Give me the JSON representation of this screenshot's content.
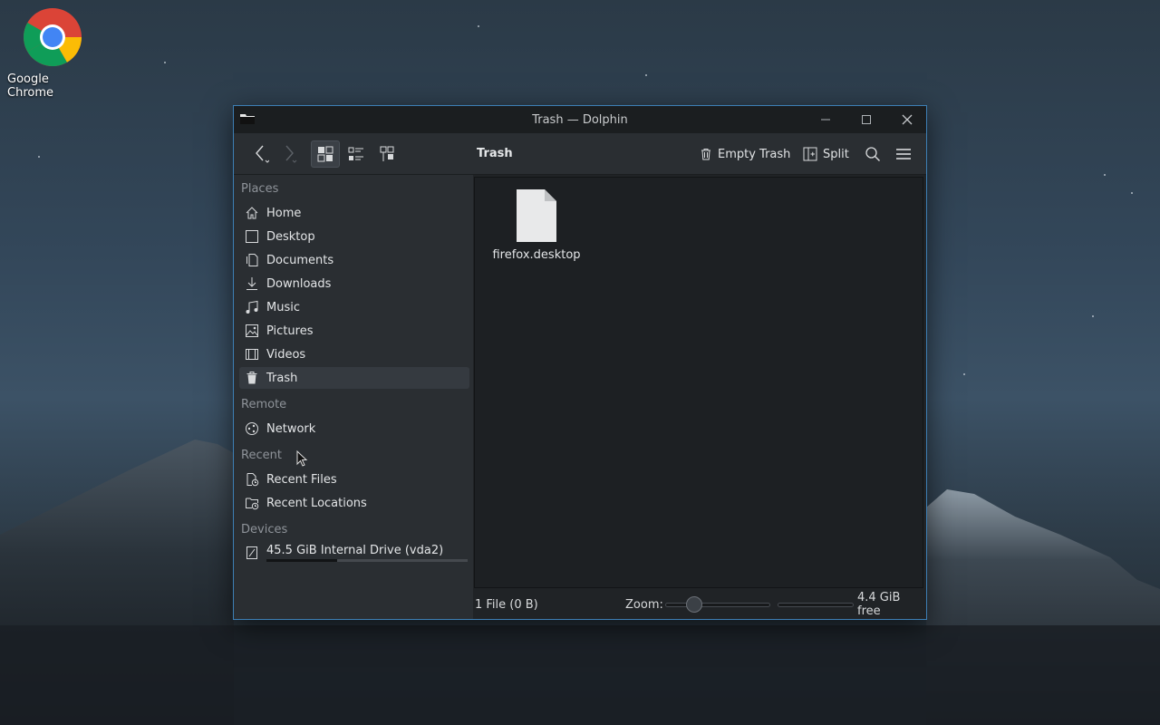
{
  "desktop": {
    "icons": [
      {
        "label": "Google Chrome",
        "icon": "chrome-icon"
      }
    ]
  },
  "window": {
    "title": "Trash — Dolphin",
    "accent": "#3d7fb5",
    "controls": [
      "minimize-icon",
      "maximize-icon",
      "close-icon"
    ]
  },
  "toolbar": {
    "location": "Trash",
    "empty_trash_label": "Empty Trash",
    "split_label": "Split",
    "view_modes": [
      "icons-view",
      "compact-view",
      "details-view"
    ],
    "active_view": "icons-view"
  },
  "sidebar": {
    "sections": {
      "places": "Places",
      "remote": "Remote",
      "recent": "Recent",
      "devices": "Devices"
    },
    "places": [
      {
        "label": "Home",
        "icon": "home-icon"
      },
      {
        "label": "Desktop",
        "icon": "desktop-icon"
      },
      {
        "label": "Documents",
        "icon": "documents-icon"
      },
      {
        "label": "Downloads",
        "icon": "downloads-icon"
      },
      {
        "label": "Music",
        "icon": "music-icon"
      },
      {
        "label": "Pictures",
        "icon": "pictures-icon"
      },
      {
        "label": "Videos",
        "icon": "videos-icon"
      },
      {
        "label": "Trash",
        "icon": "trash-icon",
        "selected": true
      }
    ],
    "remote": [
      {
        "label": "Network",
        "icon": "network-icon"
      }
    ],
    "recent": [
      {
        "label": "Recent Files",
        "icon": "recent-files-icon"
      },
      {
        "label": "Recent Locations",
        "icon": "recent-locations-icon"
      }
    ],
    "devices": [
      {
        "label": "45.5 GiB Internal Drive (vda2)",
        "icon": "drive-icon",
        "usage_fraction": 0.35
      }
    ]
  },
  "content": {
    "files": [
      {
        "name": "firefox.desktop",
        "icon": "file-icon"
      }
    ]
  },
  "statusbar": {
    "summary": "1 File (0 B)",
    "zoom_label": "Zoom:",
    "zoom_fraction": 0.28,
    "free_space": "4.4 GiB free",
    "space_used_fraction": 0.0
  }
}
